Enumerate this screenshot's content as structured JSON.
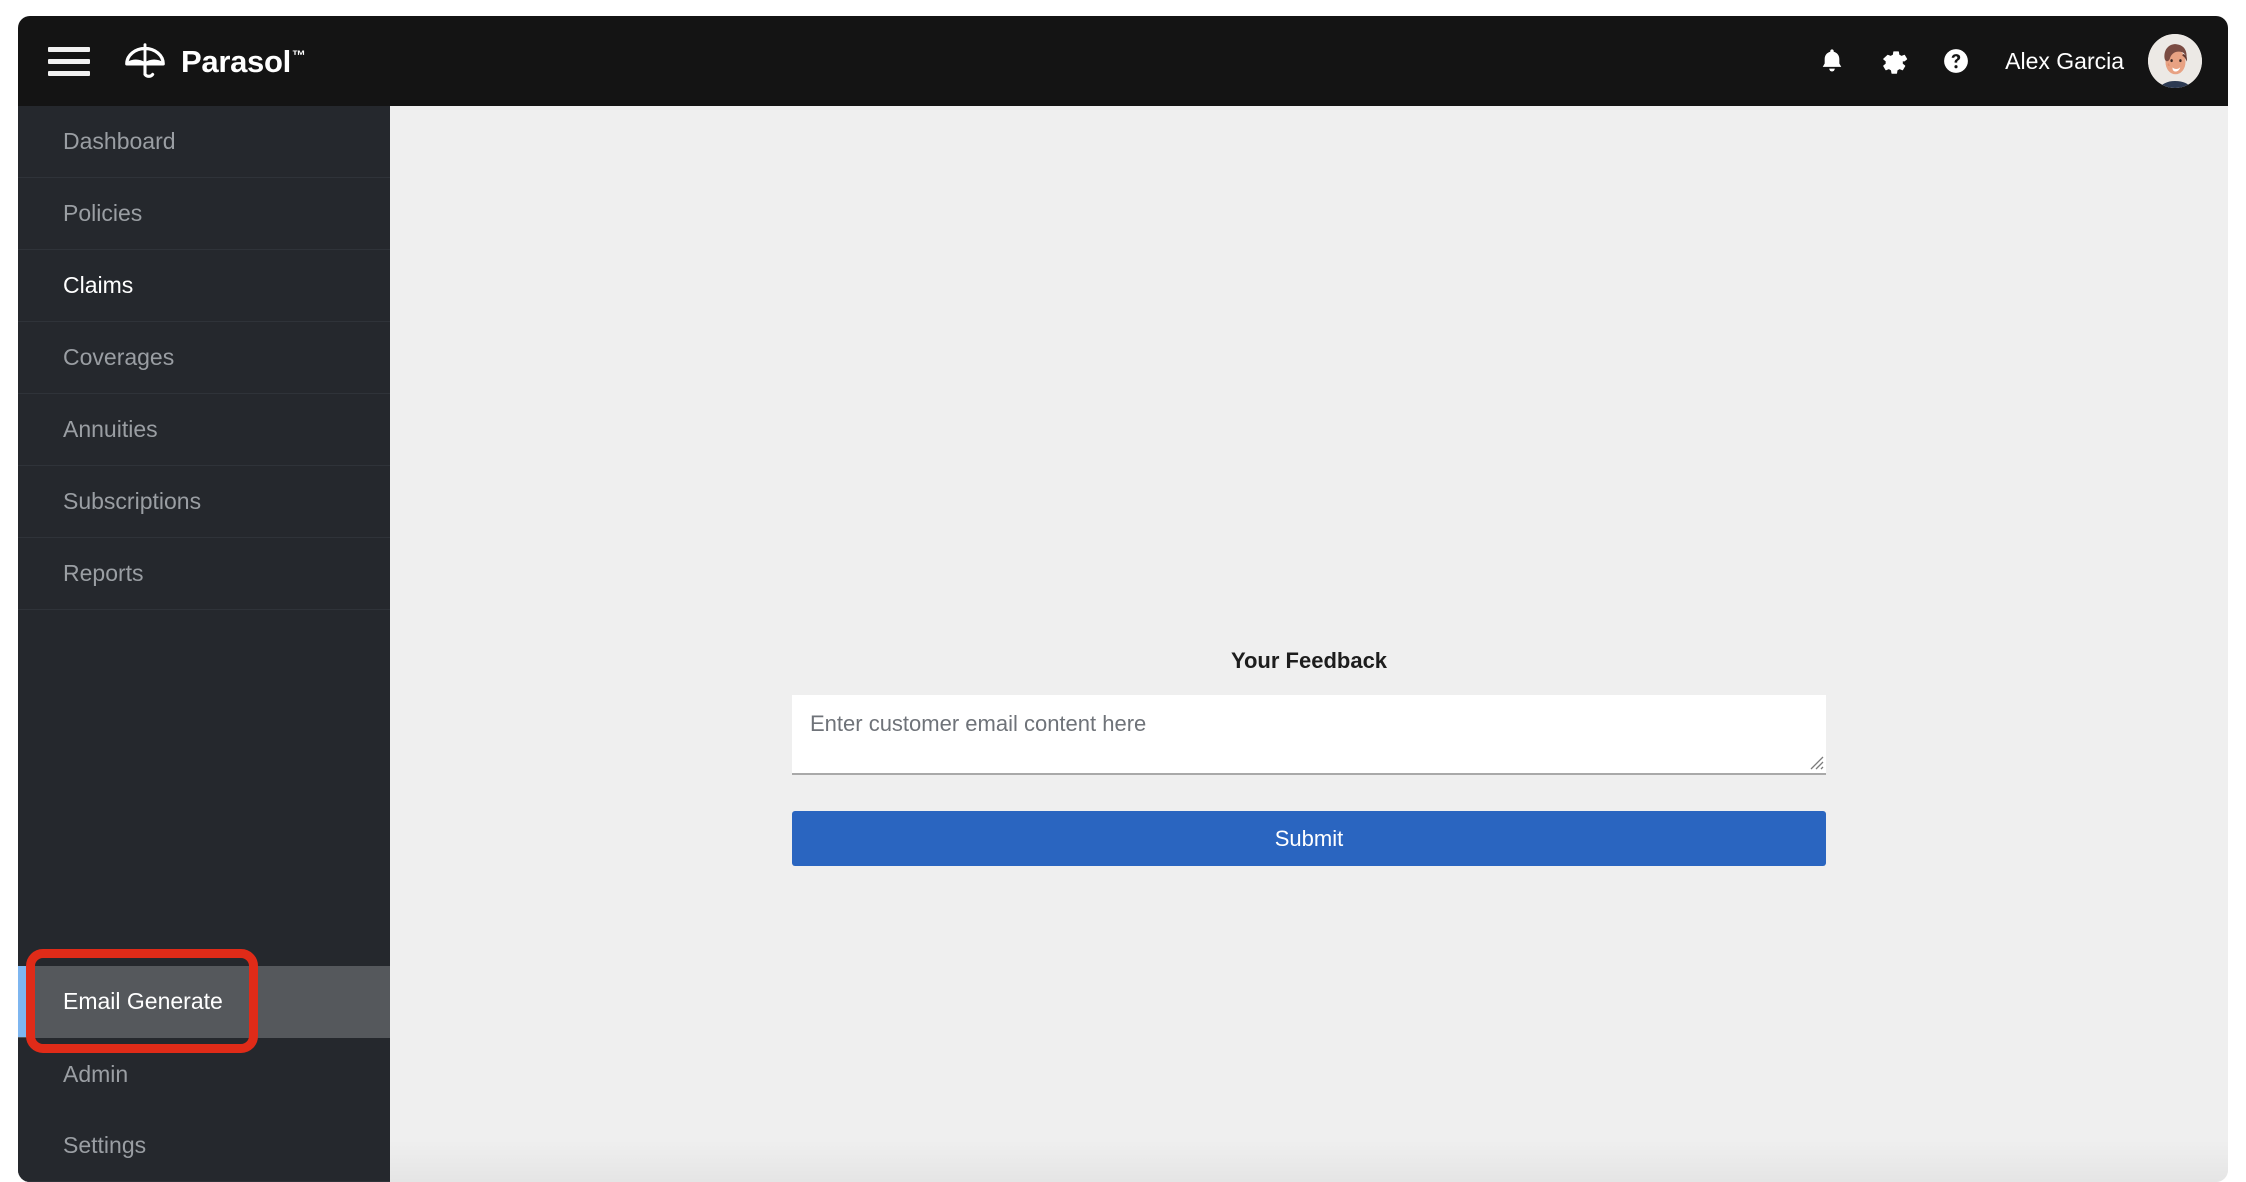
{
  "app": {
    "brand_name": "Parasol",
    "brand_tm": "™"
  },
  "header": {
    "menu_icon": "hamburger-icon",
    "logo_icon": "umbrella-icon",
    "notifications_icon": "bell-icon",
    "settings_icon": "gear-icon",
    "help_icon": "question-mark-icon",
    "user_name": "Alex Garcia",
    "avatar_icon": "user-avatar"
  },
  "sidebar": {
    "items": [
      {
        "label": "Dashboard",
        "state": "default"
      },
      {
        "label": "Policies",
        "state": "default"
      },
      {
        "label": "Claims",
        "state": "active"
      },
      {
        "label": "Coverages",
        "state": "default"
      },
      {
        "label": "Annuities",
        "state": "default"
      },
      {
        "label": "Subscriptions",
        "state": "default"
      },
      {
        "label": "Reports",
        "state": "default"
      }
    ],
    "bottom_items": [
      {
        "label": "Email Generate",
        "state": "highlighted"
      },
      {
        "label": "Admin",
        "state": "default"
      },
      {
        "label": "Settings",
        "state": "default"
      }
    ]
  },
  "main": {
    "feedback_title": "Your Feedback",
    "feedback_value": "",
    "feedback_placeholder": "Enter customer email content here",
    "submit_label": "Submit"
  },
  "annotation": {
    "target": "Email Generate",
    "color": "#e02b18"
  },
  "colors": {
    "header_bg": "#141414",
    "sidebar_bg": "#25282d",
    "sidebar_highlight_bg": "#55585c",
    "sidebar_accent": "#7eb6f0",
    "content_bg": "#efefef",
    "primary_button": "#2a65c0",
    "annotation_red": "#e02b18"
  }
}
